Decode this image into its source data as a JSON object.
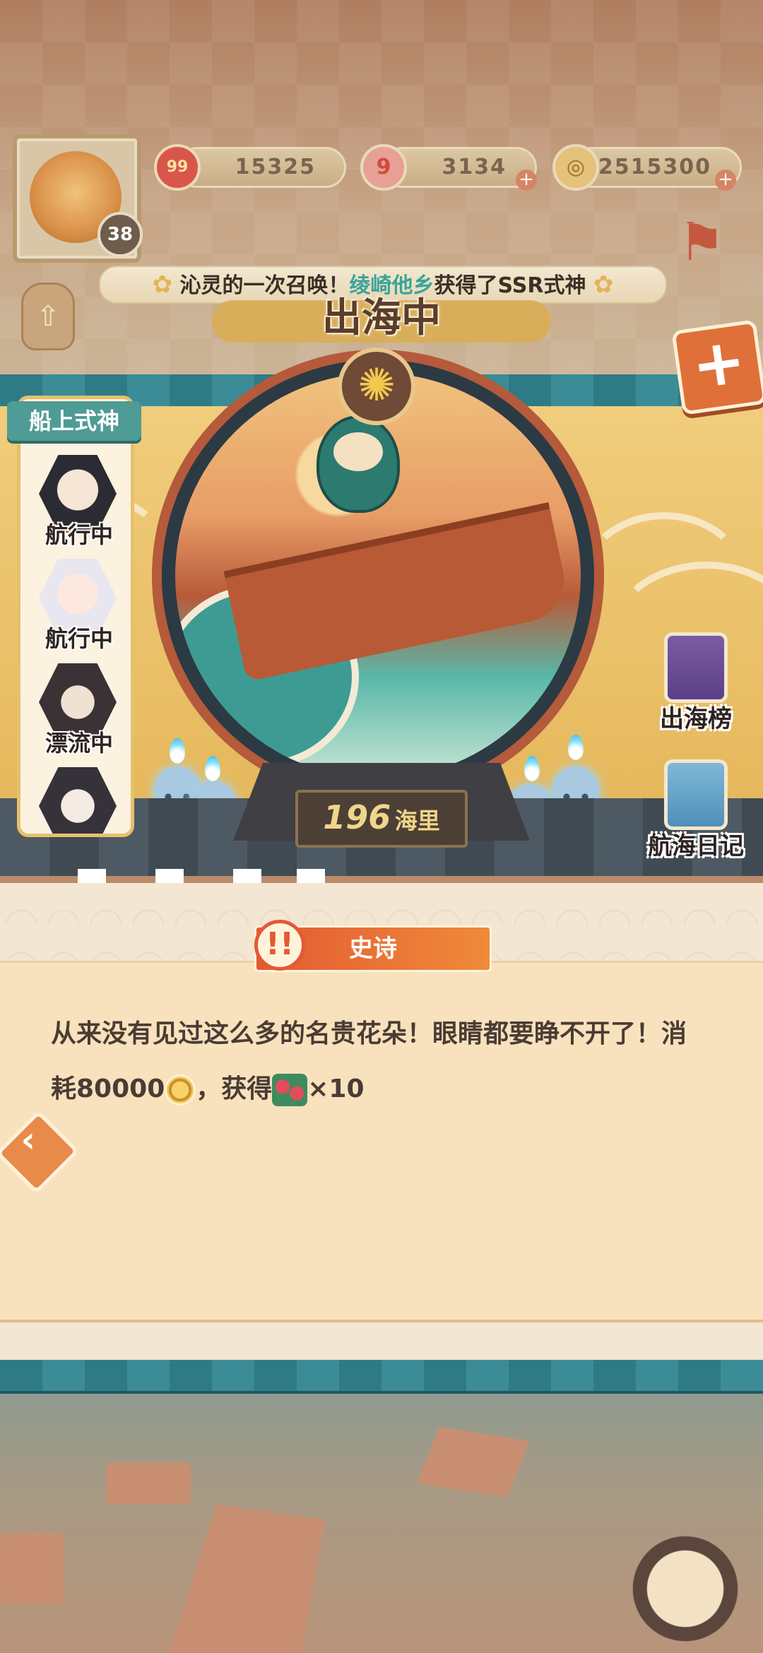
{
  "resources": {
    "level": "38",
    "amulet_icon_text": "99",
    "amulet_value": "15325",
    "jade_icon_text": "9",
    "jade_value": "3134",
    "coin_value": "2515300",
    "plus_symbol": "+"
  },
  "ticker": {
    "prefix": "沁灵的一次召唤！",
    "player": "绫崎他乡",
    "suffix": "获得了SSR式神"
  },
  "status_title": "出海中",
  "crew": {
    "title": "船上式神",
    "members": [
      {
        "status": "航行中"
      },
      {
        "status": "航行中"
      },
      {
        "status": "漂流中"
      },
      {
        "status": ""
      }
    ]
  },
  "distance": {
    "value": "196",
    "unit": "海里"
  },
  "side_buttons": {
    "ranking": "出海榜",
    "diary": "航海日记"
  },
  "event": {
    "rarity": "史诗",
    "line1": "从来没有见过这么多的名贵花朵！眼睛都要睁不开了！消",
    "line2_pre": "耗80000",
    "line2_mid": "，获得",
    "line2_post": "×10"
  },
  "icons": {
    "add": "plus-icon",
    "back": "chevron-left-icon",
    "fish": "fish-icon",
    "lantern": "lantern-icon",
    "sun": "sunflower-icon"
  },
  "colors": {
    "teal": "#2f7b85",
    "gold": "#e6b85c",
    "rarity": "#e35a32"
  }
}
